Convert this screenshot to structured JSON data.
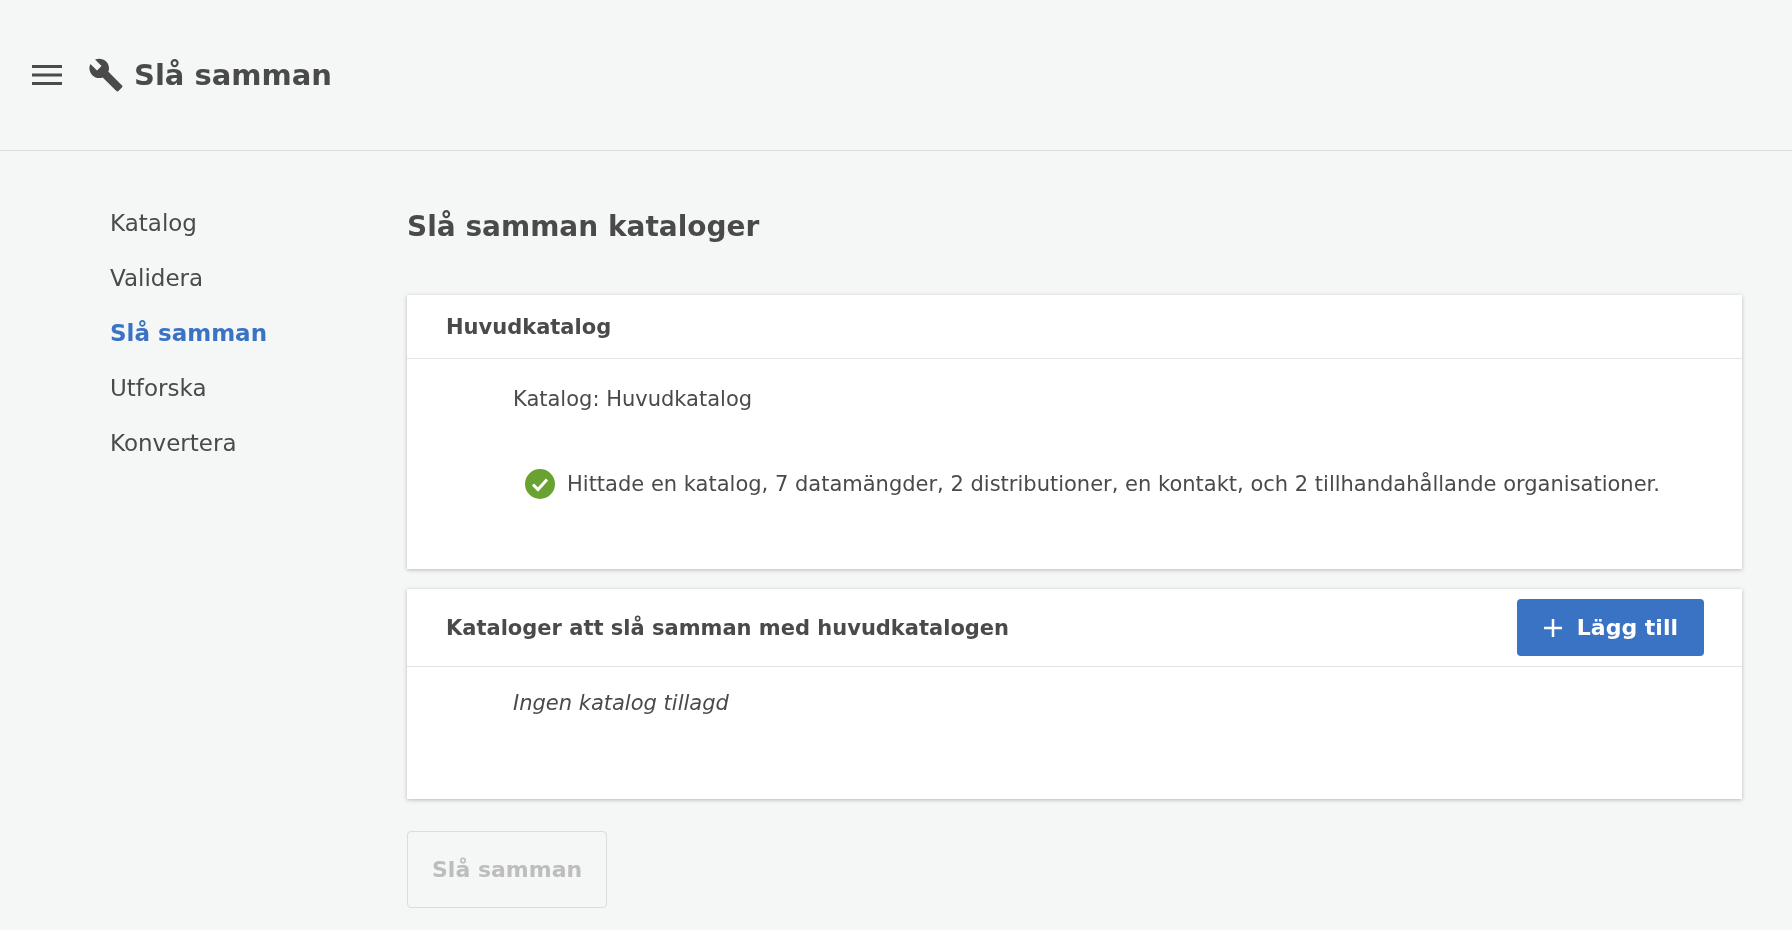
{
  "header": {
    "title": "Slå samman"
  },
  "sidebar": {
    "items": [
      {
        "label": "Katalog",
        "selected": false
      },
      {
        "label": "Validera",
        "selected": false
      },
      {
        "label": "Slå samman",
        "selected": true
      },
      {
        "label": "Utforska",
        "selected": false
      },
      {
        "label": "Konvertera",
        "selected": false
      }
    ]
  },
  "page": {
    "title": "Slå samman kataloger"
  },
  "main_catalog": {
    "title": "Huvudkatalog",
    "catalog_line": "Katalog: Huvudkatalog",
    "result": {
      "ok": true,
      "text": "Hittade en katalog, 7 datamängder, 2 distributioner, en kontakt, och 2 tillhandahållande organisationer."
    }
  },
  "merge_catalogs": {
    "title": "Kataloger att slå samman med huvudkatalogen",
    "add_button": "Lägg till",
    "empty_text": "Ingen katalog tillagd"
  },
  "merge_button": {
    "label": "Slå samman",
    "disabled": true
  }
}
